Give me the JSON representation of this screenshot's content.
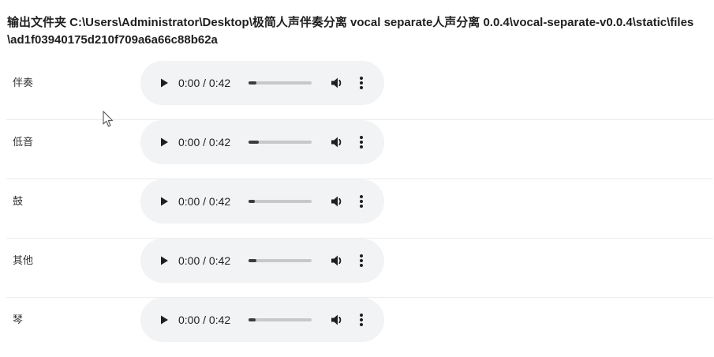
{
  "header": {
    "output_folder_text": "输出文件夹 C:\\Users\\Administrator\\Desktop\\极简人声伴奏分离 vocal separate人声分离 0.0.4\\vocal-separate-v0.0.4\\static\\files\\ad1f03940175d210f709a6a66c88b62a"
  },
  "tracks": [
    {
      "label": "伴奏",
      "time": "0:00 / 0:42",
      "progress": 0.12
    },
    {
      "label": "低音",
      "time": "0:00 / 0:42",
      "progress": 0.16
    },
    {
      "label": "鼓",
      "time": "0:00 / 0:42",
      "progress": 0.1
    },
    {
      "label": "其他",
      "time": "0:00 / 0:42",
      "progress": 0.12
    },
    {
      "label": "琴",
      "time": "0:00 / 0:42",
      "progress": 0.11
    }
  ],
  "icons": {
    "play": "play-icon",
    "volume": "volume-icon",
    "menu": "more-vertical-icon",
    "cursor": "mouse-pointer-icon"
  },
  "colors": {
    "player_background": "#f1f3f4",
    "seek_fill": "#3c3c3c",
    "seek_track": "#c8c8c8"
  }
}
